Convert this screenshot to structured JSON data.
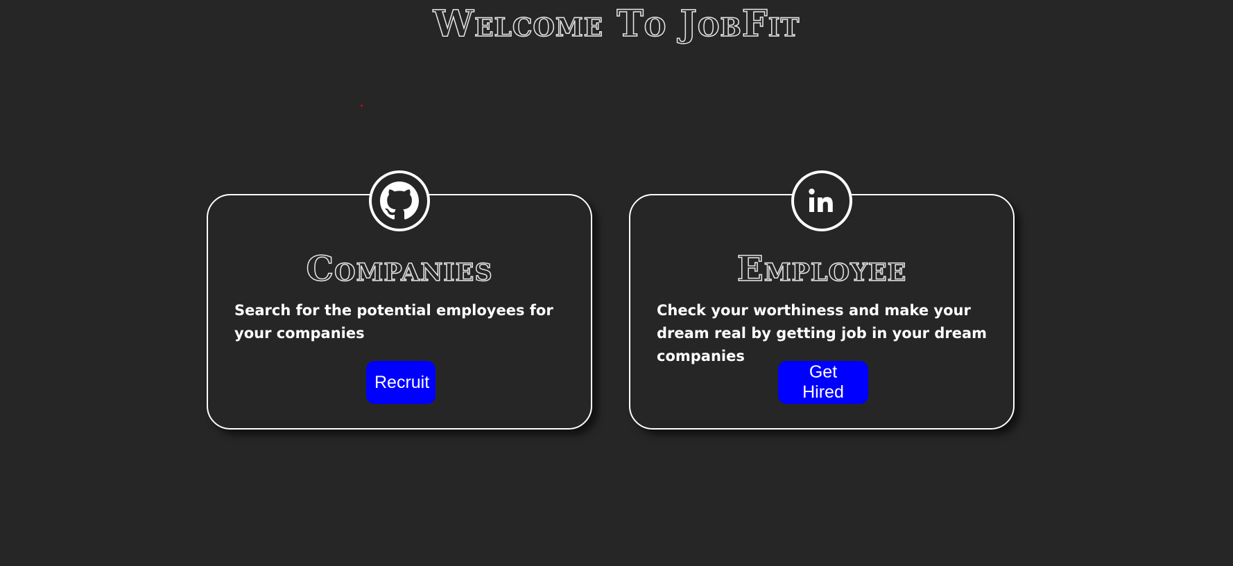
{
  "header": {
    "title": "Welcome To JobFit"
  },
  "cards": [
    {
      "icon": "github-icon",
      "title": "Companies",
      "description": "Search for the potential employees for your companies",
      "button_label": "Recruit"
    },
    {
      "icon": "linkedin-icon",
      "title": "Employee",
      "description": "Check your worthiness and make your dream real by getting job in your dream companies",
      "button_label": "Get Hired"
    }
  ],
  "colors": {
    "background": "#262626",
    "button": "#0000ff",
    "border": "#ffffff",
    "dot": "#e00000"
  }
}
